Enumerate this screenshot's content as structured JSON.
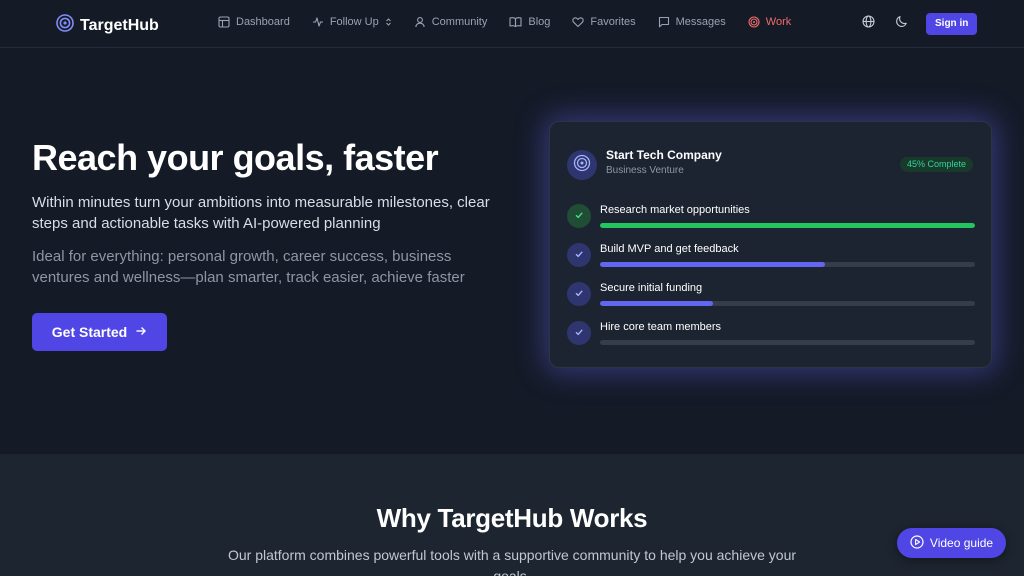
{
  "brand": {
    "name": "TargetHub",
    "logo_icon": "target-icon",
    "accent": "#4f46e5"
  },
  "nav": {
    "items": [
      {
        "label": "Dashboard",
        "icon": "dashboard-icon"
      },
      {
        "label": "Follow Up",
        "icon": "activity-icon",
        "has_dropdown": true
      },
      {
        "label": "Community",
        "icon": "user-icon"
      },
      {
        "label": "Blog",
        "icon": "book-icon"
      },
      {
        "label": "Favorites",
        "icon": "heart-icon"
      },
      {
        "label": "Messages",
        "icon": "message-icon"
      },
      {
        "label": "Work",
        "icon": "target-icon",
        "active": true,
        "color": "#f26b6b"
      }
    ],
    "sign_in": "Sign in"
  },
  "hero": {
    "headline": "Reach your goals, faster",
    "subtitle": "Within minutes turn your ambitions into measurable milestones, clear steps and actionable tasks with AI-powered planning",
    "description": "Ideal for everything: personal growth, career success, business ventures and wellness—plan smarter, track easier, achieve faster",
    "cta": "Get Started"
  },
  "goal_card": {
    "title": "Start Tech Company",
    "subtitle": "Business Venture",
    "badge": "45% Complete",
    "tasks": [
      {
        "label": "Research market opportunities",
        "progress": 1.0,
        "color": "#22c55e",
        "done": true
      },
      {
        "label": "Build MVP and get feedback",
        "progress": 0.6,
        "color": "#6366f1",
        "done": false
      },
      {
        "label": "Secure initial funding",
        "progress": 0.3,
        "color": "#6366f1",
        "done": false
      },
      {
        "label": "Hire core team members",
        "progress": 0.0,
        "color": "#6366f1",
        "done": false
      }
    ]
  },
  "features": {
    "title": "Why TargetHub Works",
    "text": "Our platform combines powerful tools with a supportive community to help you achieve your goals."
  },
  "video_guide": "Video guide"
}
